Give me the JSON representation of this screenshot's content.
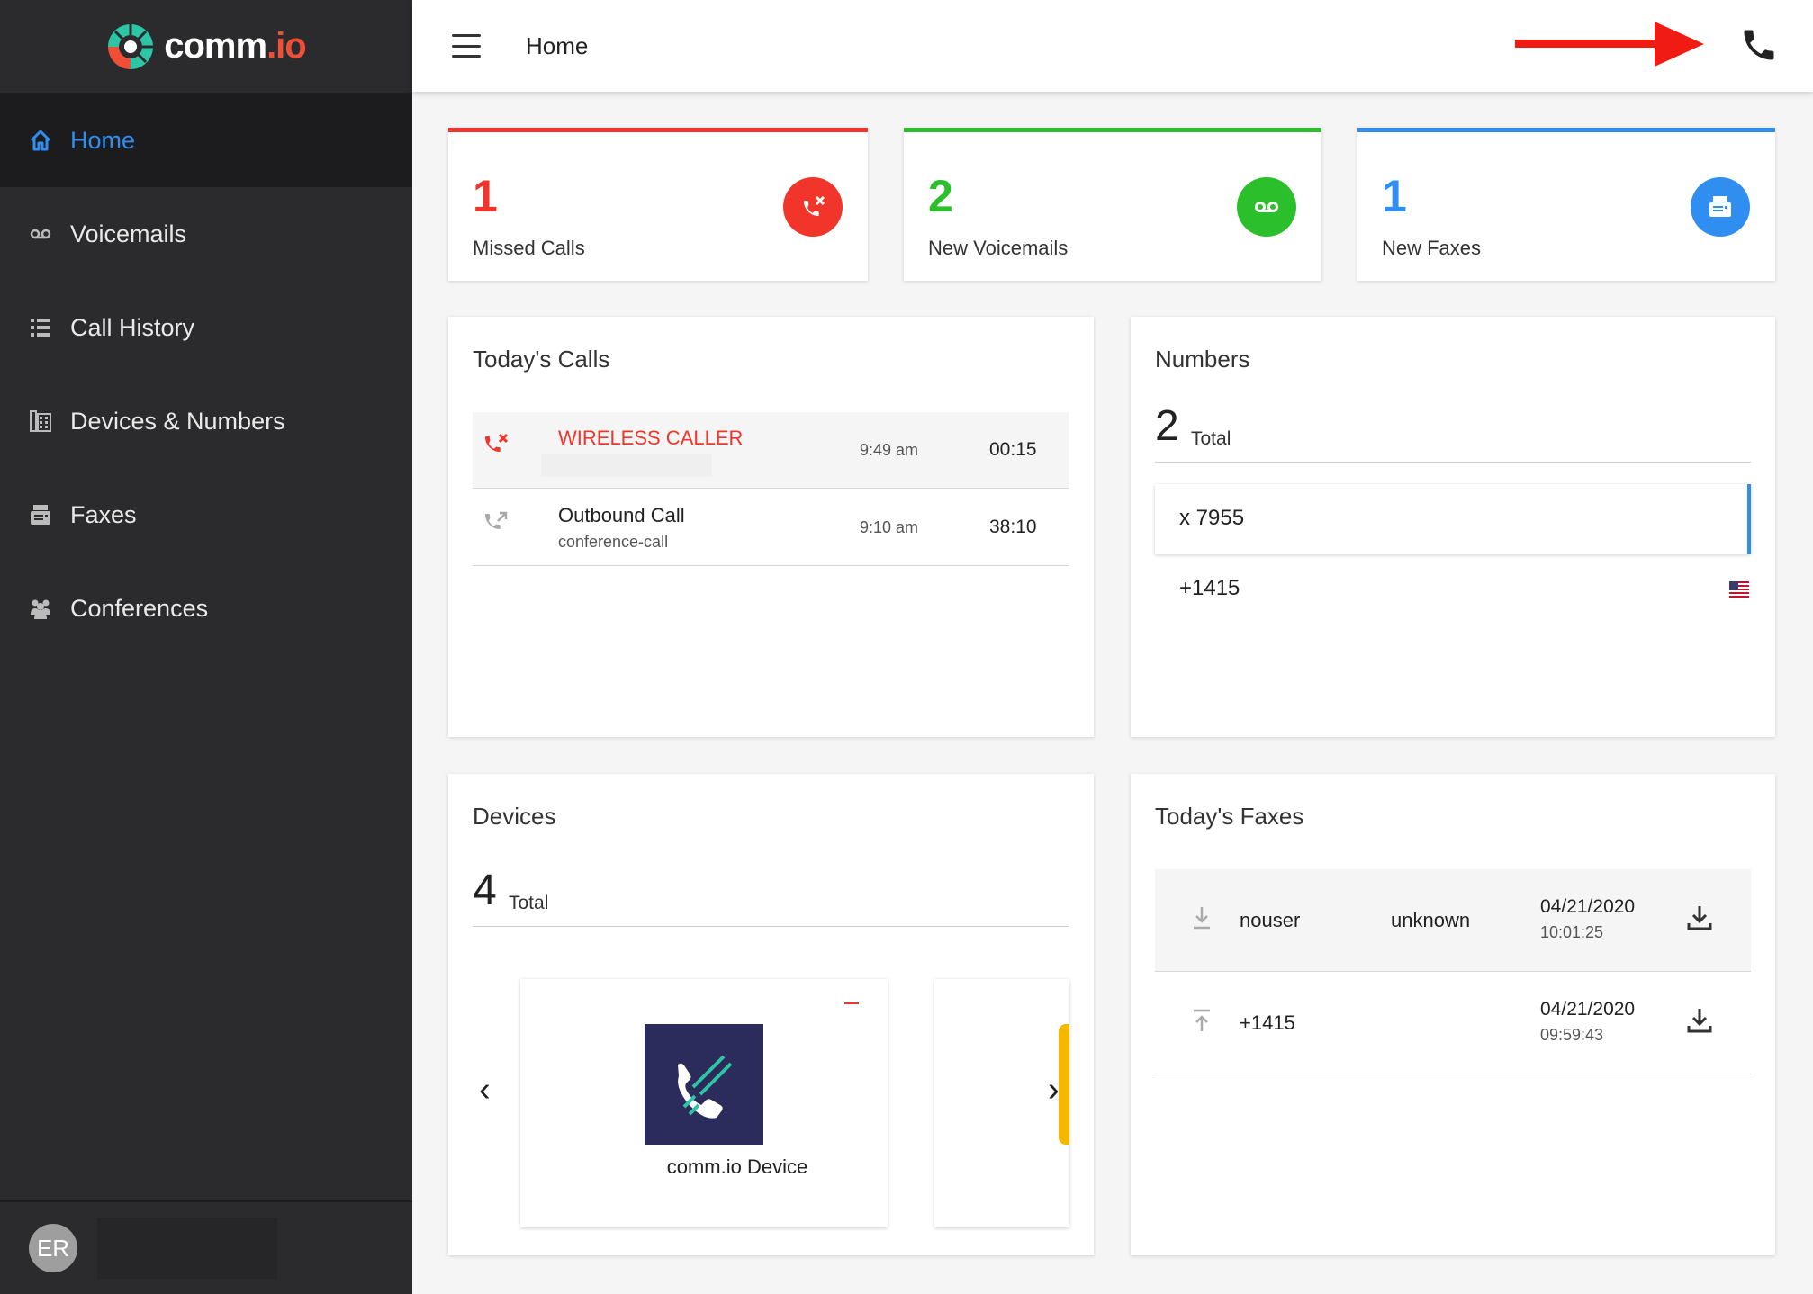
{
  "brand": {
    "name_main": "comm",
    "name_accent": ".io"
  },
  "header": {
    "title": "Home"
  },
  "sidebar": {
    "items": [
      {
        "label": "Home",
        "icon": "home-icon"
      },
      {
        "label": "Voicemails",
        "icon": "voicemail-icon"
      },
      {
        "label": "Call History",
        "icon": "list-icon"
      },
      {
        "label": "Devices & Numbers",
        "icon": "devices-icon"
      },
      {
        "label": "Faxes",
        "icon": "fax-icon"
      },
      {
        "label": "Conferences",
        "icon": "conference-icon"
      }
    ],
    "user_initials": "ER"
  },
  "stats": [
    {
      "value": "1",
      "label": "Missed Calls",
      "color": "#f2352a",
      "icon": "missed-call-icon"
    },
    {
      "value": "2",
      "label": "New Voicemails",
      "color": "#2cbf2c",
      "icon": "voicemail-icon"
    },
    {
      "value": "1",
      "label": "New Faxes",
      "color": "#2f8ef0",
      "icon": "fax-icon"
    }
  ],
  "todays_calls": {
    "title": "Today's Calls",
    "rows": [
      {
        "name": "WIRELESS CALLER",
        "sub": "",
        "time": "9:49 am",
        "duration": "00:15",
        "type": "missed"
      },
      {
        "name": "Outbound Call",
        "sub": "conference-call",
        "time": "9:10 am",
        "duration": "38:10",
        "type": "outbound"
      }
    ]
  },
  "numbers": {
    "title": "Numbers",
    "total": "2",
    "total_label": "Total",
    "rows": [
      {
        "value": "x 7955"
      },
      {
        "value": "+1415"
      }
    ]
  },
  "devices": {
    "title": "Devices",
    "total": "4",
    "total_label": "Total",
    "card_label": "comm.io Device",
    "prev": "‹",
    "next": "›"
  },
  "todays_faxes": {
    "title": "Today's Faxes",
    "rows": [
      {
        "from": "nouser",
        "to": "unknown",
        "date": "04/21/2020",
        "time": "10:01:25",
        "direction": "incoming"
      },
      {
        "from": "+1415",
        "to": "",
        "date": "04/21/2020",
        "time": "09:59:43",
        "direction": "outgoing"
      }
    ]
  },
  "colors": {
    "accent": "#2f8ef0",
    "missed": "#f2352a",
    "voicemail": "#2cbf2c",
    "sidebar": "#2b2b2d",
    "arrow": "#f01c14"
  }
}
